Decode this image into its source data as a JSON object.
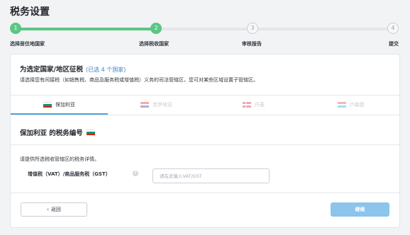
{
  "page": {
    "title": "税务设置"
  },
  "stepper": {
    "steps": [
      {
        "number": "1",
        "label": "选择居住地国家",
        "state": "done"
      },
      {
        "number": "2",
        "label": "选择税收国家",
        "state": "done"
      },
      {
        "number": "3",
        "label": "审核报告",
        "state": "todo"
      },
      {
        "number": "4",
        "label": "提交",
        "state": "todo"
      }
    ],
    "progress_percent": 40
  },
  "jurisdiction": {
    "title": "为选定国家/地区征税",
    "selected_count": "(已选 4 个国家)",
    "description": "请选择您有间接税（如销售税、商品及服务税或增值税）义务的司法管辖区，您可对某些区域设置子管辖区。"
  },
  "tabs": [
    {
      "label": "保加利亚",
      "flag": "bulgaria-flag",
      "active": true
    },
    {
      "label": "克罗地亚",
      "flag": "croatia-flag",
      "active": false
    },
    {
      "label": "丹麦",
      "flag": "denmark-flag",
      "active": false
    },
    {
      "label": "卢森堡",
      "flag": "luxembourg-flag",
      "active": false
    }
  ],
  "tax_number": {
    "title": "保加利亚 的税务编号",
    "description": "请提供所选税收管辖区的税务详情。",
    "field_label": "增值税（VAT）/商品服务税（GST）",
    "input_value": "",
    "input_placeholder": "请在此输入VAT/GST"
  },
  "actions": {
    "back_label": "返回",
    "continue_label": "继续"
  },
  "colors": {
    "accent_green": "#5cc584",
    "accent_blue": "#4aa3df",
    "continue_disabled": "#8cc4ec"
  }
}
